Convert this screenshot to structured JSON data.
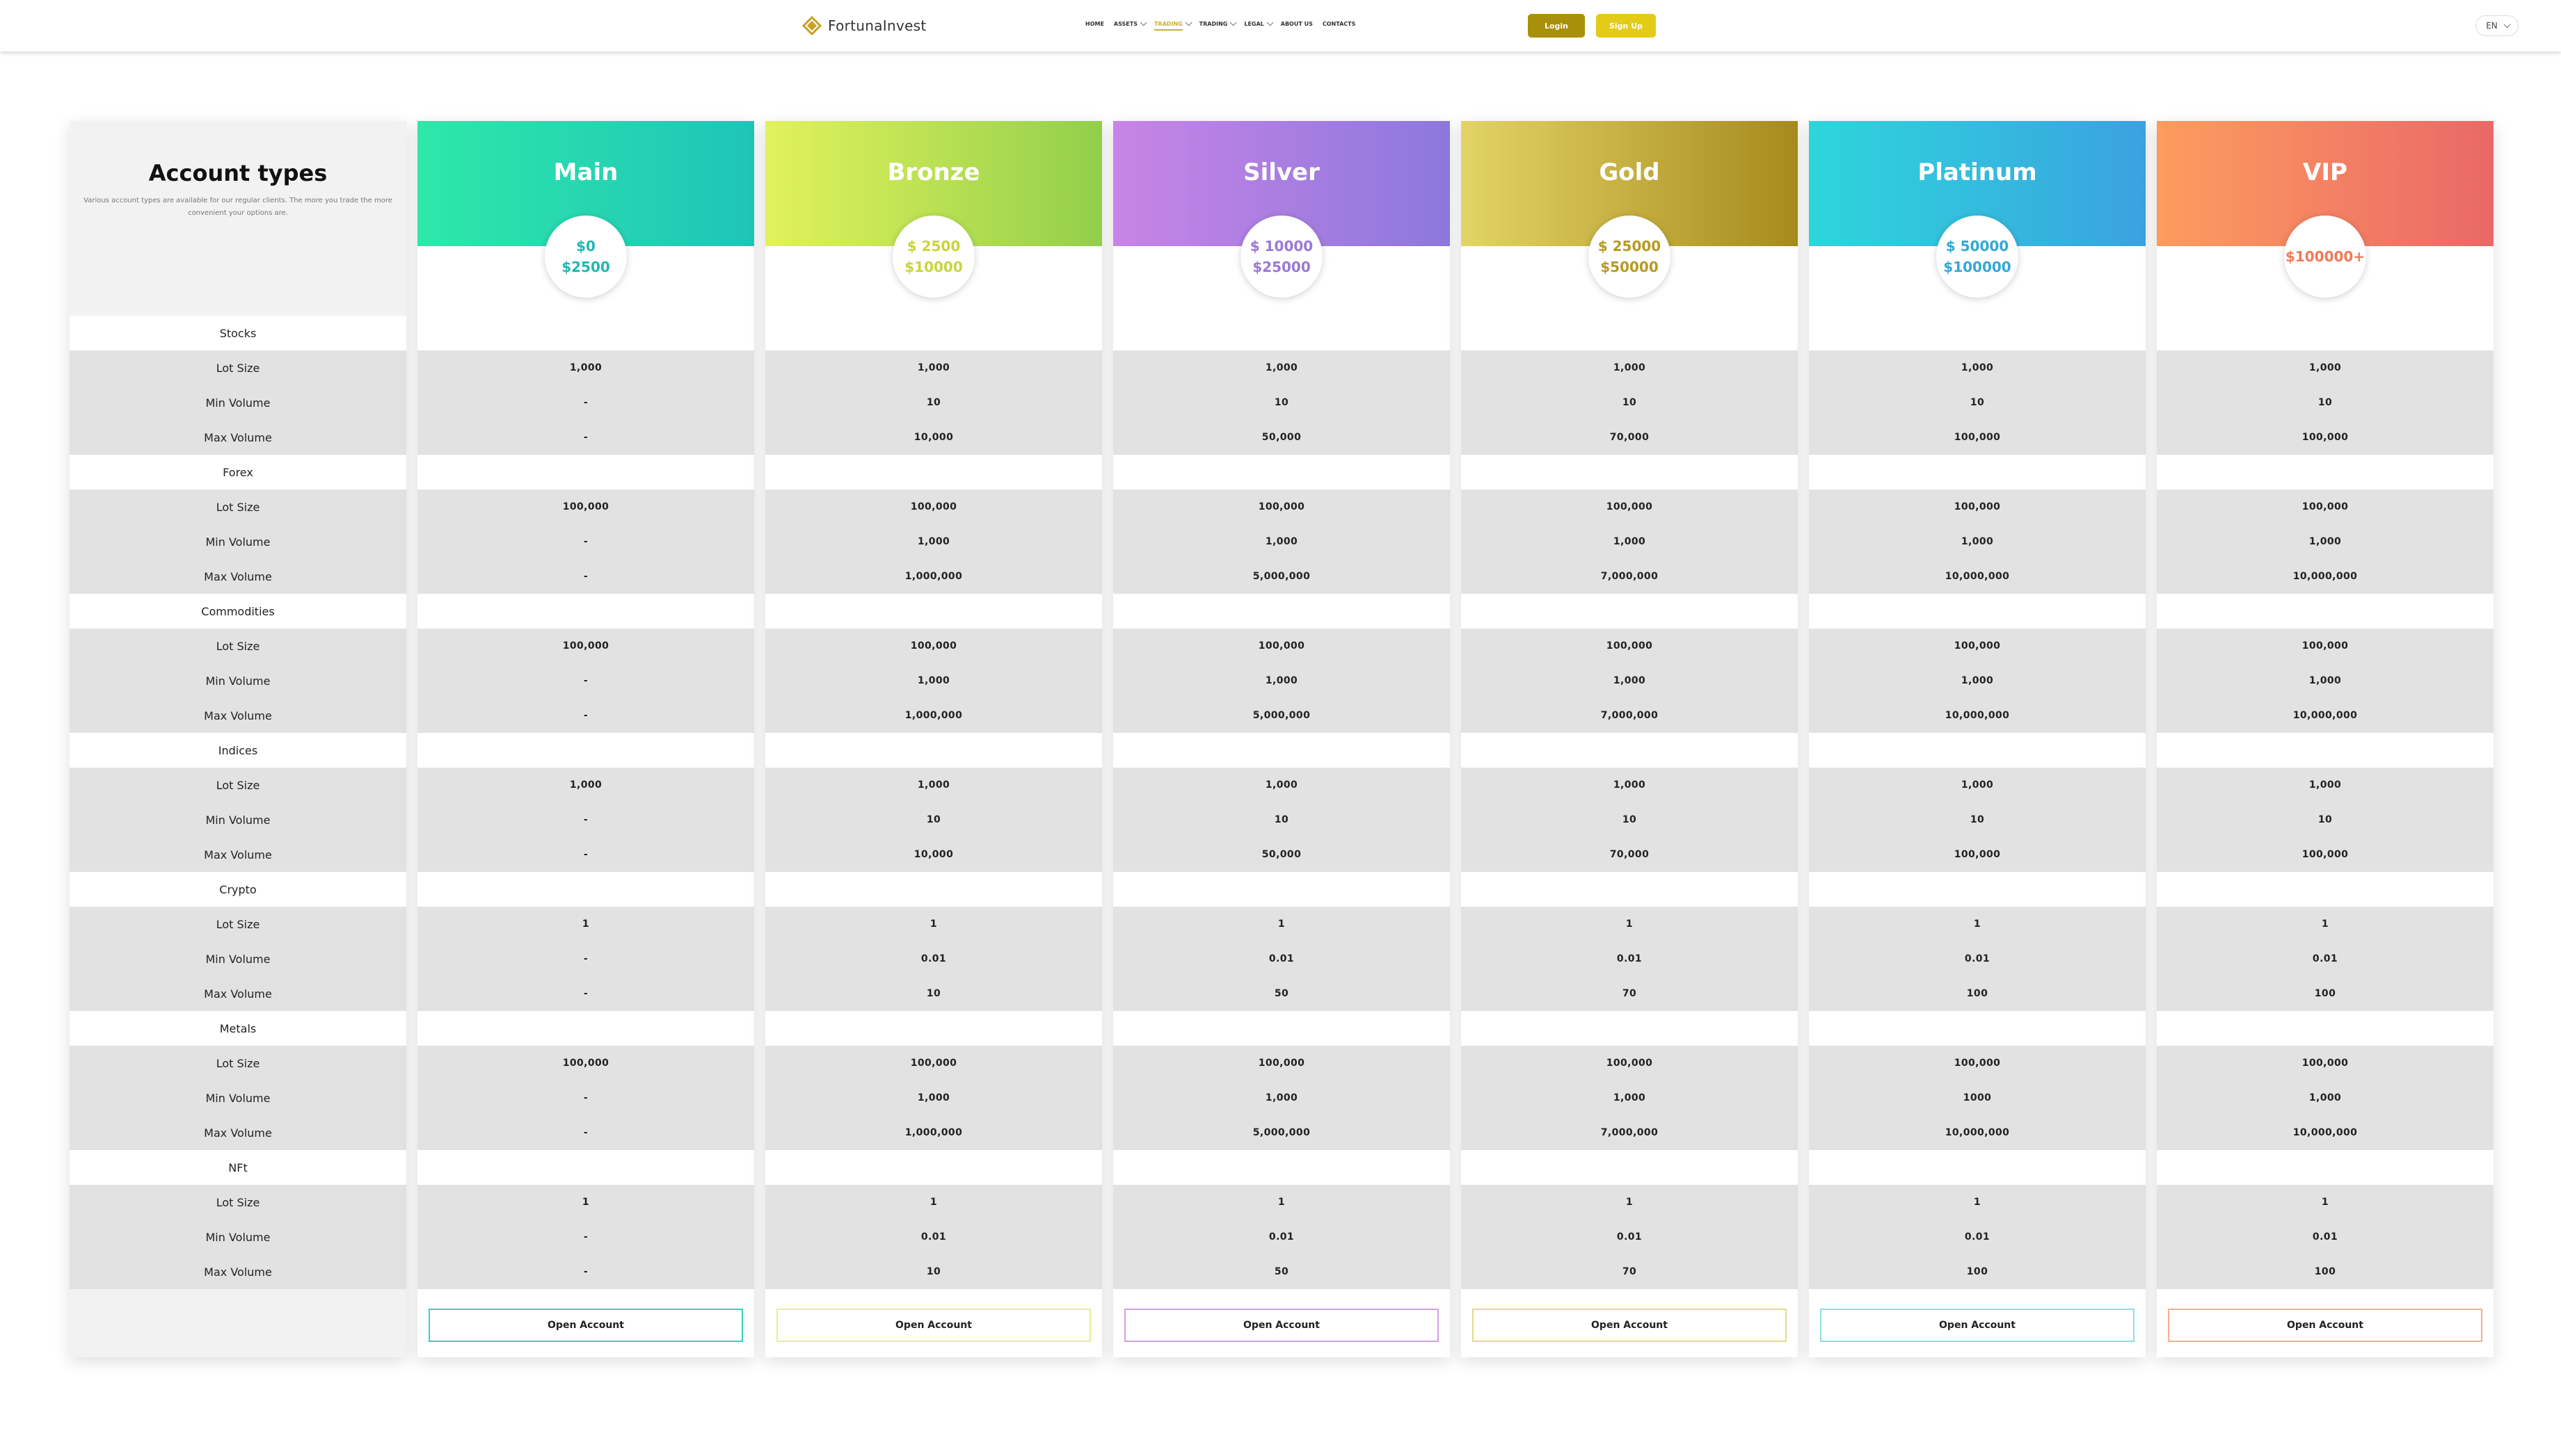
{
  "header": {
    "logo_text": "FortunaInvest",
    "nav": [
      {
        "label": "HOME",
        "has_dropdown": false,
        "active": false
      },
      {
        "label": "ASSETS",
        "has_dropdown": true,
        "active": false
      },
      {
        "label": "TRADING",
        "has_dropdown": true,
        "active": true
      },
      {
        "label": "TRADING",
        "has_dropdown": true,
        "active": false
      },
      {
        "label": "LEGAL",
        "has_dropdown": true,
        "active": false
      },
      {
        "label": "ABOUT US",
        "has_dropdown": false,
        "active": false
      },
      {
        "label": "CONTACTS",
        "has_dropdown": false,
        "active": false
      }
    ],
    "login_label": "Login",
    "signup_label": "Sign Up",
    "language": "EN",
    "colors": {
      "login": "#a8900b",
      "signup": "#e4cb18",
      "accent": "#c9b227"
    }
  },
  "intro": {
    "title": "Account types",
    "description": "Various account types are available for our regular clients. The more you trade the more convenient your options are."
  },
  "sections": [
    {
      "name": "Stocks",
      "rows": [
        "Lot Size",
        "Min Volume",
        "Max Volume"
      ]
    },
    {
      "name": "Forex",
      "rows": [
        "Lot Size",
        "Min Volume",
        "Max Volume"
      ]
    },
    {
      "name": "Commodities",
      "rows": [
        "Lot Size",
        "Min Volume",
        "Max Volume"
      ]
    },
    {
      "name": "Indices",
      "rows": [
        "Lot Size",
        "Min Volume",
        "Max Volume"
      ]
    },
    {
      "name": "Crypto",
      "rows": [
        "Lot Size",
        "Min Volume",
        "Max Volume"
      ]
    },
    {
      "name": "Metals",
      "rows": [
        "Lot Size",
        "Min Volume",
        "Max Volume"
      ]
    },
    {
      "name": "NFt",
      "rows": [
        "Lot Size",
        "Min Volume",
        "Max Volume"
      ]
    }
  ],
  "accounts": [
    {
      "name": "Main",
      "price_line1": "$0",
      "price_line2": "$2500",
      "gradient": [
        "#2ee8a8",
        "#1fc4b9"
      ],
      "price_color": "#1fb8b0",
      "button_border": "#3ccdc0",
      "open_label": "Open Account",
      "values": [
        [
          "1,000",
          "-",
          "-"
        ],
        [
          "100,000",
          "-",
          "-"
        ],
        [
          "100,000",
          "-",
          "-"
        ],
        [
          "1,000",
          "-",
          "-"
        ],
        [
          "1",
          "-",
          "-"
        ],
        [
          "100,000",
          "-",
          "-"
        ],
        [
          "1",
          "-",
          "-"
        ]
      ]
    },
    {
      "name": "Bronze",
      "price_line1": "$ 2500",
      "price_line2": "$10000",
      "gradient": [
        "#e2f25c",
        "#92cf4b"
      ],
      "price_color": "#c9d53a",
      "button_border": "#e9ec9a",
      "open_label": "Open Account",
      "values": [
        [
          "1,000",
          "10",
          "10,000"
        ],
        [
          "100,000",
          "1,000",
          "1,000,000"
        ],
        [
          "100,000",
          "1,000",
          "1,000,000"
        ],
        [
          "1,000",
          "10",
          "10,000"
        ],
        [
          "1",
          "0.01",
          "10"
        ],
        [
          "100,000",
          "1,000",
          "1,000,000"
        ],
        [
          "1",
          "0.01",
          "10"
        ]
      ]
    },
    {
      "name": "Silver",
      "price_line1": "$ 10000",
      "price_line2": "$25000",
      "gradient": [
        "#c884e6",
        "#8c78dc"
      ],
      "price_color": "#9a78d8",
      "button_border": "#d69ee8",
      "open_label": "Open Account",
      "values": [
        [
          "1,000",
          "10",
          "50,000"
        ],
        [
          "100,000",
          "1,000",
          "5,000,000"
        ],
        [
          "100,000",
          "1,000",
          "5,000,000"
        ],
        [
          "1,000",
          "10",
          "50,000"
        ],
        [
          "1",
          "0.01",
          "50"
        ],
        [
          "100,000",
          "1,000",
          "5,000,000"
        ],
        [
          "1",
          "0.01",
          "50"
        ]
      ]
    },
    {
      "name": "Gold",
      "price_line1": "$ 25000",
      "price_line2": "$50000",
      "gradient": [
        "#e3d465",
        "#a68a1c"
      ],
      "price_color": "#b89a22",
      "button_border": "#e6d98a",
      "open_label": "Open Account",
      "values": [
        [
          "1,000",
          "10",
          "70,000"
        ],
        [
          "100,000",
          "1,000",
          "7,000,000"
        ],
        [
          "100,000",
          "1,000",
          "7,000,000"
        ],
        [
          "1,000",
          "10",
          "70,000"
        ],
        [
          "1",
          "0.01",
          "70"
        ],
        [
          "100,000",
          "1,000",
          "7,000,000"
        ],
        [
          "1",
          "0.01",
          "70"
        ]
      ]
    },
    {
      "name": "Platinum",
      "price_line1": "$ 50000",
      "price_line2": "$100000",
      "gradient": [
        "#2ed6dc",
        "#3aa2e0"
      ],
      "price_color": "#32a8d8",
      "button_border": "#8ee0e6",
      "open_label": "Open Account",
      "values": [
        [
          "1,000",
          "10",
          "100,000"
        ],
        [
          "100,000",
          "1,000",
          "10,000,000"
        ],
        [
          "100,000",
          "1,000",
          "10,000,000"
        ],
        [
          "1,000",
          "10",
          "100,000"
        ],
        [
          "1",
          "0.01",
          "100"
        ],
        [
          "100,000",
          "1000",
          "10,000,000"
        ],
        [
          "1",
          "0.01",
          "100"
        ]
      ]
    },
    {
      "name": "VIP",
      "price_line1": "$100000+",
      "price_line2": "",
      "gradient": [
        "#fd9c5e",
        "#ea6868"
      ],
      "price_color": "#ef7a5a",
      "button_border": "#f6b090",
      "open_label": "Open Account",
      "values": [
        [
          "1,000",
          "10",
          "100,000"
        ],
        [
          "100,000",
          "1,000",
          "10,000,000"
        ],
        [
          "100,000",
          "1,000",
          "10,000,000"
        ],
        [
          "1,000",
          "10",
          "100,000"
        ],
        [
          "1",
          "0.01",
          "100"
        ],
        [
          "100,000",
          "1,000",
          "10,000,000"
        ],
        [
          "1",
          "0.01",
          "100"
        ]
      ]
    }
  ]
}
